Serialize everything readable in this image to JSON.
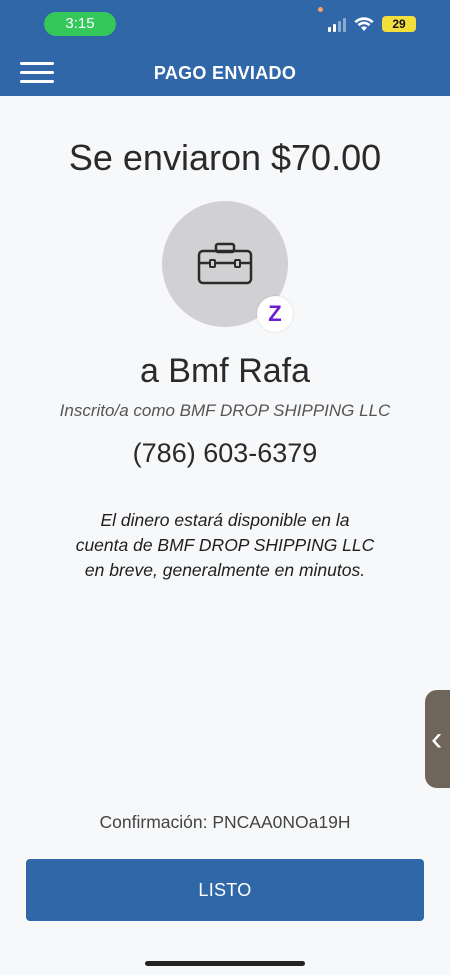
{
  "status_bar": {
    "time": "3:15",
    "battery": "29"
  },
  "header": {
    "title": "PAGO ENVIADO"
  },
  "main": {
    "amount_title": "Se enviaron $70.00",
    "zelle_badge": "Z",
    "recipient_name": "a Bmf Rafa",
    "enrolled_as": "Inscrito/a como BMF DROP SHIPPING LLC",
    "phone": "(786) 603-6379",
    "message_lines": [
      "El dinero estará disponible en la",
      "cuenta de BMF DROP SHIPPING LLC",
      "en breve, generalmente en minutos."
    ],
    "confirmation": "Confirmación: PNCAA0NOa19H",
    "done_label": "LISTO"
  },
  "side_handle": {
    "glyph": "‹"
  },
  "colors": {
    "brand_blue": "#2f67a8",
    "zelle_purple": "#6d1ed4",
    "time_pill_green": "#34c759",
    "battery_yellow": "#f2df3c"
  },
  "icons": [
    "menu-icon",
    "signal-icon",
    "wifi-icon",
    "battery-icon",
    "briefcase-icon",
    "zelle-icon",
    "chevron-left-icon"
  ]
}
